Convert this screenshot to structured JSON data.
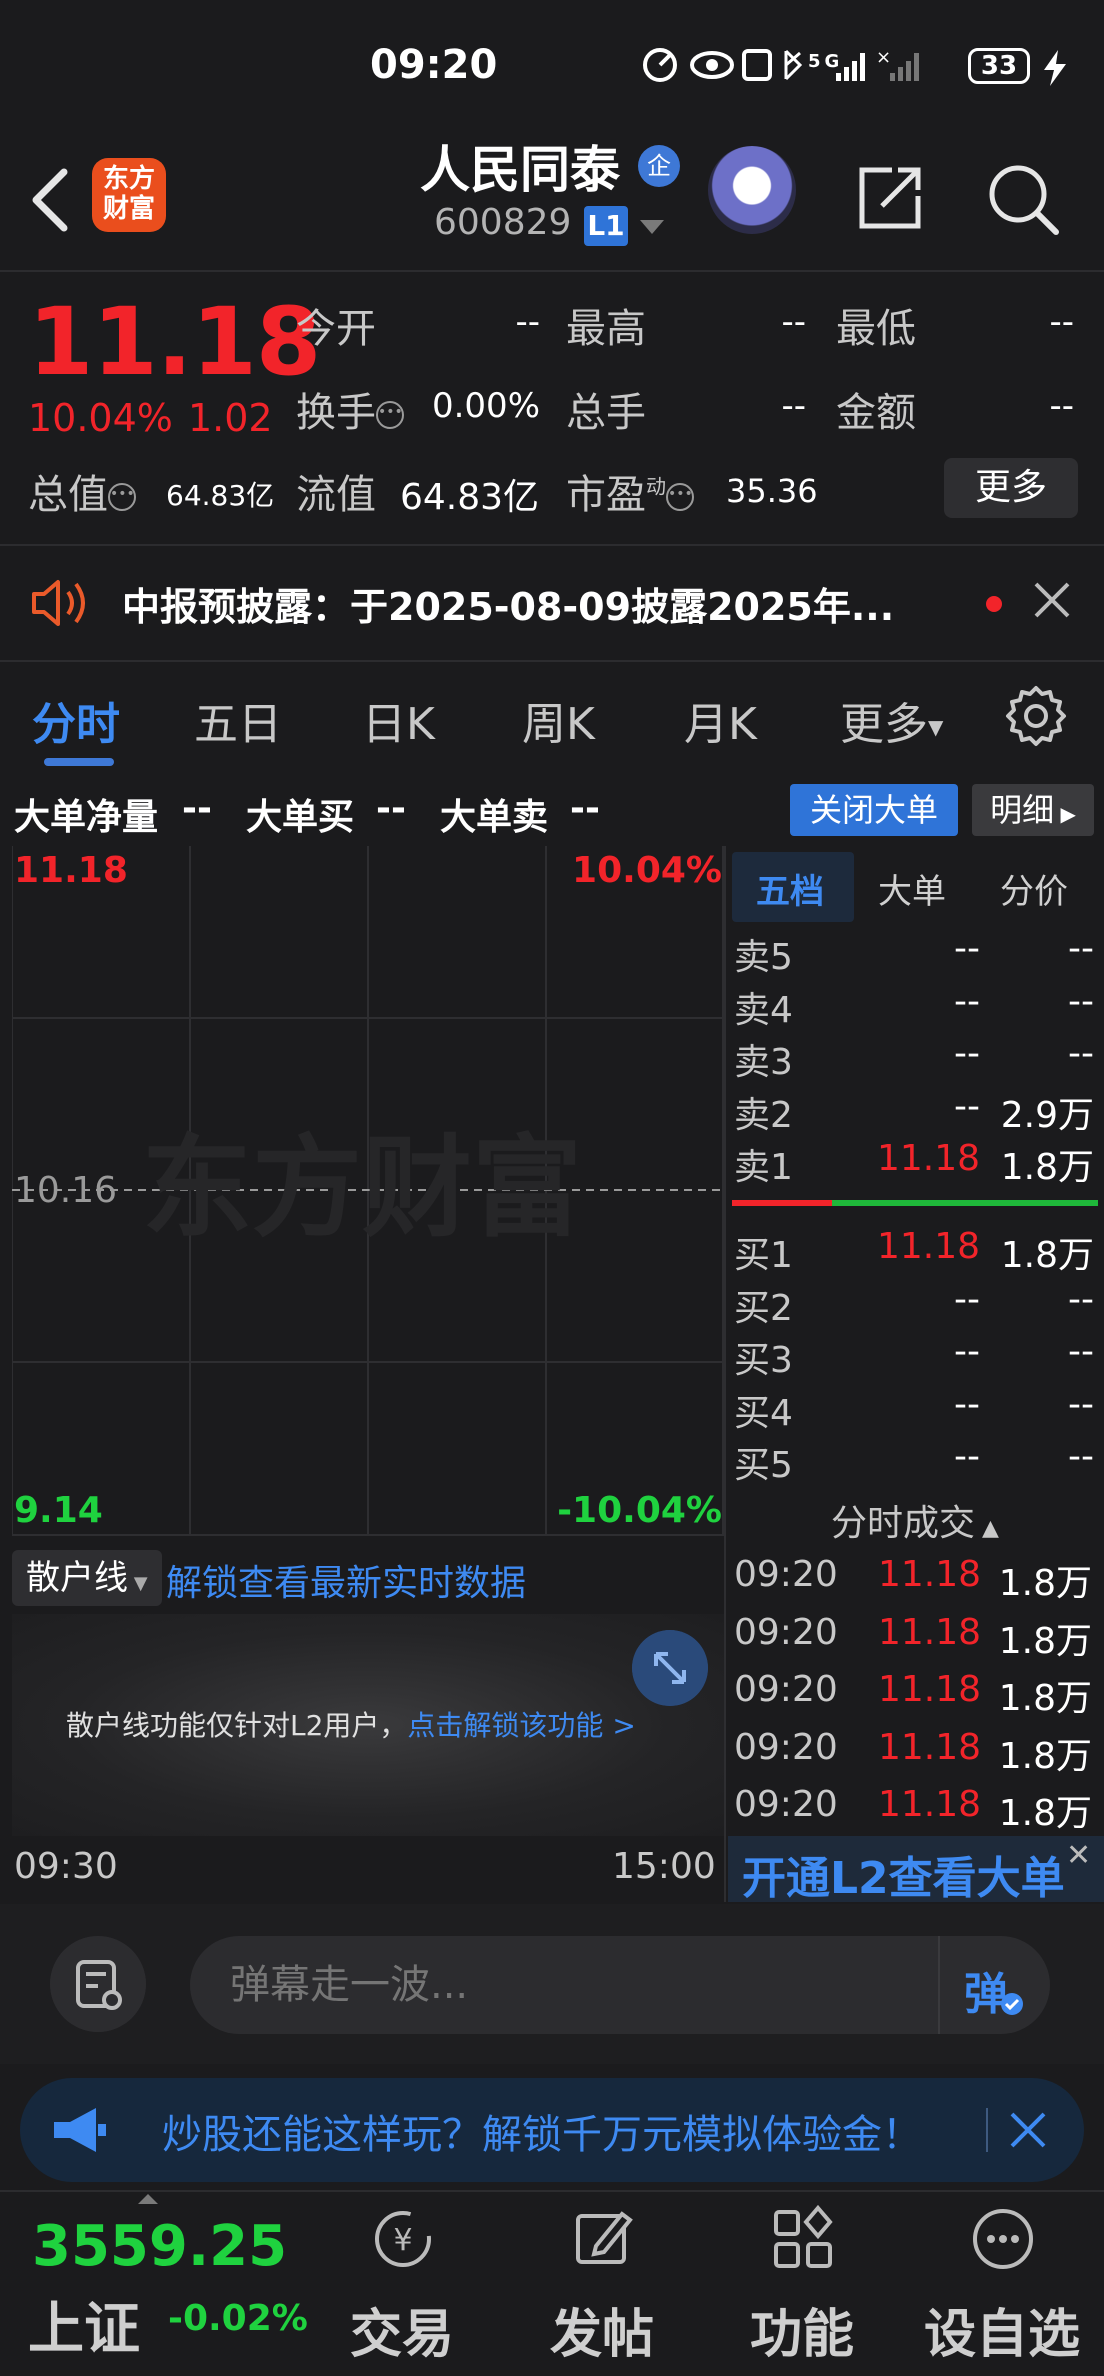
{
  "status_bar": {
    "time": "09:20",
    "battery": "33",
    "network": "5G"
  },
  "header": {
    "logo_text": [
      "东方",
      "财富"
    ],
    "stock_name": "人民同泰",
    "enterprise_badge": "企",
    "stock_code": "600829",
    "level_badge": "L1"
  },
  "quote": {
    "price": "11.18",
    "change_pct": "10.04%",
    "change_abs": "1.02",
    "fields": {
      "open_label": "今开",
      "open_value": "--",
      "high_label": "最高",
      "high_value": "--",
      "low_label": "最低",
      "low_value": "--",
      "turnover_label": "换手",
      "turnover_value": "0.00%",
      "volume_label": "总手",
      "volume_value": "--",
      "amount_label": "金额",
      "amount_value": "--",
      "mktcap_label": "总值",
      "mktcap_value": "64.83亿",
      "float_label": "流值",
      "float_value": "64.83亿",
      "pe_label": "市盈",
      "pe_sup": "动",
      "pe_value": "35.36"
    },
    "more_label": "更多"
  },
  "announcement": {
    "text": "中报预披露：于2025-08-09披露2025年..."
  },
  "tabs": [
    "分时",
    "五日",
    "日K",
    "周K",
    "月K",
    "更多"
  ],
  "big_order": {
    "net_label": "大单净量",
    "net_value": "--",
    "buy_label": "大单买",
    "buy_value": "--",
    "sell_label": "大单卖",
    "sell_value": "--",
    "close_button": "关闭大单",
    "detail_button": "明细"
  },
  "chart_data": {
    "type": "line",
    "y_top_price": "11.18",
    "y_top_pct": "10.04%",
    "y_mid_price": "10.16",
    "y_bottom_price": "9.14",
    "y_bottom_pct": "-10.04%",
    "ylim": [
      9.14,
      11.18
    ],
    "x_start": "09:30",
    "x_end": "15:00",
    "watermark": "东方财富",
    "series": []
  },
  "order_book": {
    "tabs": [
      "五档",
      "大单",
      "分价"
    ],
    "sell": [
      {
        "label": "卖5",
        "price": "--",
        "vol": "--"
      },
      {
        "label": "卖4",
        "price": "--",
        "vol": "--"
      },
      {
        "label": "卖3",
        "price": "--",
        "vol": "--"
      },
      {
        "label": "卖2",
        "price": "--",
        "vol": "2.9万"
      },
      {
        "label": "卖1",
        "price": "11.18",
        "vol": "1.8万"
      }
    ],
    "buy": [
      {
        "label": "买1",
        "price": "11.18",
        "vol": "1.8万"
      },
      {
        "label": "买2",
        "price": "--",
        "vol": "--"
      },
      {
        "label": "买3",
        "price": "--",
        "vol": "--"
      },
      {
        "label": "买4",
        "price": "--",
        "vol": "--"
      },
      {
        "label": "买5",
        "price": "--",
        "vol": "--"
      }
    ],
    "trades_title": "分时成交",
    "trades": [
      {
        "time": "09:20",
        "price": "11.18",
        "vol": "1.8万"
      },
      {
        "time": "09:20",
        "price": "11.18",
        "vol": "1.8万"
      },
      {
        "time": "09:20",
        "price": "11.18",
        "vol": "1.8万"
      },
      {
        "time": "09:20",
        "price": "11.18",
        "vol": "1.8万"
      },
      {
        "time": "09:20",
        "price": "11.18",
        "vol": "1.8万"
      }
    ]
  },
  "retail_line": {
    "select_label": "散户线",
    "unlock_text": "解锁查看最新实时数据",
    "note": "散户线功能仅针对L2用户，",
    "note_link": "点击解锁该功能 >"
  },
  "l2_banner": "开通L2查看大单",
  "comment": {
    "placeholder": "弹幕走一波...",
    "send_label": "弹"
  },
  "promo": {
    "text": "炒股还能这样玩？解锁千万元模拟体验金！"
  },
  "bottom_nav": {
    "index_value": "3559.25",
    "index_name": "上证",
    "index_change": "-0.02%",
    "items": [
      "交易",
      "发帖",
      "功能",
      "设自选"
    ]
  },
  "colors": {
    "up": "#f2242a",
    "down": "#1fb83a",
    "accent": "#3e78d6",
    "background": "#1b1b1d"
  }
}
